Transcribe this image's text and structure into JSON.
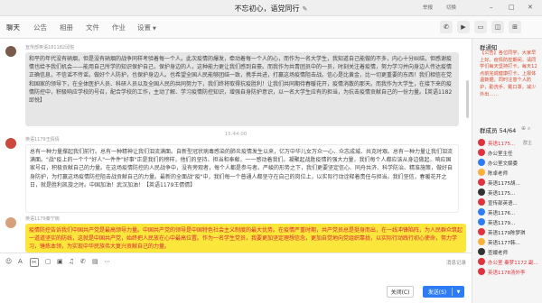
{
  "window": {
    "title": "不忘初心，语党同行",
    "title_edit_icon": "pencil-icon",
    "menu_items": [
      "举报",
      "切换"
    ],
    "controls": [
      "minimize-icon",
      "maximize-icon",
      "close-icon"
    ]
  },
  "tabs": [
    {
      "label": "聊天",
      "active": true
    },
    {
      "label": "公告"
    },
    {
      "label": "相册"
    },
    {
      "label": "文件"
    },
    {
      "label": "作业"
    },
    {
      "label": "设置",
      "dropdown": true
    }
  ],
  "header_tools": [
    "phone-icon",
    "video-icon",
    "screen-share-icon",
    "group-apps-icon",
    "more-icon"
  ],
  "messages": [
    {
      "sender": "宣传部英语181182邱悦",
      "text": "和平的年代没有硝烟，但是没有硝烟的战争同样考验着每一个人。此次疫情的爆发，牵动着每一个人的心，而作为一名大学生，我知道自己能做的不多，内心十分纠结，但感谢疫情也给予我们机会——能用自己所学的知识保护自己，保护身边的人，这种能力更让我们感到自豪。而我作为共青团员中的一员，时刻关注着疫情，努力学习并向身边人传达疫情正确信息，不信谣不传谣，做好个人防护，也保护身边人。也希望全国人民能够团结一致，携手共进，打赢这场疫情阻击战。信心是比黄金，比一切更重要的东西！我们相信在党和国家的领导下，在全体医护人员、科研人员以及全国人民的共同努力下，我们终将取得抗疫胜利！让我们共同期待春暖花开，疫情消散的那天。而我作为大学生，在接下来的疫情防控中，积极响应学校的号召，配合学校的工作，主动了解、学习疫情防控知识，增强自身防护意识，以一名大学生应有的担当，为抗击疫情贡献自己的一份力量。【英语1182邱悦】"
    },
    {
      "timestamp": "15:44:00"
    },
    {
      "sender": "英语1179王倩倩",
      "text": "总有一种力量撑起我们前行。总有一种精神让我们泪流满面。自新型冠状病毒感染的肺炎疫情发生以来，亿万中华儿女万众一心、众志成城、共克时艰。总有一种力量让我们泪流满面。\"战\"疫上的一个个\"好人\"一件件\"好事\"正是我们的榜样，他们的坚持、担当和奉献，一一感动着我们。凝聚起战胜疫情的强大力量，我们每个人都应该从身边做起，响应国家号召，积极贡献自己的力量。在这场疫情防控的人民战争中，没有旁观者，每个人都是参与者。严峻的形势之下，我们更要坚定信心、同舟共济、科学防治、精准施策，做好自身防护，为打赢这场疫情防控阻击战贡献自己的力量。最新的全面战\"疫\"中，我们每一个普通人都坚守在自己的岗位上，以实际行动诠释着责任与担当。我们坚信，春暖花开之日，就是胜利凯旋之时。中国加油！武汉加油！【英语1179王倩倩】"
    },
    {
      "sender": "英语1179秦宁婉",
      "text": "疫情防控告诉我们中国共产党是最高领导力量。中国共产党的领导是中国特色社会主义制度的最大优势。在疫情严重时期，共产党员总是挺身而出，在一线冲锋陷阵，为人民群众筑起一道道坚实的防线，这就是中国共产党，始终把人民放在心中最高位置。作为一名学生党员，我要更加坚定理想信念，更加自觉地向党组织靠拢，以实际行动践行初心使命，努力学习，锤炼本领，为实现中华民族伟大复兴贡献自己的力量。"
    }
  ],
  "input_toolbar": {
    "icons": [
      "emoji-icon",
      "font-icon",
      "scissors-icon",
      "folder-icon",
      "image-icon",
      "music-icon",
      "phone-icon",
      "red-packet-icon",
      "more-icon"
    ],
    "history_label": "消息记录",
    "close_label": "关闭(C)",
    "send_label": "发送(S)"
  },
  "right_panel": {
    "notice_title": "群通知",
    "notice_text": "【公告】各位同学，大家早上好。疫情防控期间，请同学们每天坚持打卡，每天12点前完成健康打卡，上报体温数据，同时注意个人防护，勤洗手、戴口罩，减少外出……",
    "members_title": "群成员",
    "members_count": "54/64",
    "members": [
      {
        "name": "英语1175...",
        "tag": "群主",
        "color": "#e0323c",
        "red": true
      },
      {
        "name": "办公室主任",
        "color": "#e0323c"
      },
      {
        "name": "办公室文娱委",
        "color": "#2d7cf6"
      },
      {
        "name": "陈卓老师",
        "color": "#fbb03b"
      },
      {
        "name": "英语1175胡...",
        "color": "#e0323c"
      },
      {
        "name": "英语1175...",
        "color": "#333333"
      },
      {
        "name": "宣传部英语...",
        "color": "#e0323c"
      },
      {
        "name": "英语1176...",
        "color": "#2d7cf6"
      },
      {
        "name": "英语1179...",
        "color": "#2d7cf6"
      },
      {
        "name": "英语1179陈梦琪",
        "color": "#e0323c"
      },
      {
        "name": "英语1177韩...",
        "color": "#fbb03b"
      },
      {
        "name": "查娥老师",
        "color": "#333333"
      },
      {
        "name": "办公室 秦梦1172 副...",
        "color": "#e0323c",
        "red": true
      },
      {
        "name": "英语1178汤外李",
        "color": "#e0323c",
        "red": true
      }
    ]
  }
}
